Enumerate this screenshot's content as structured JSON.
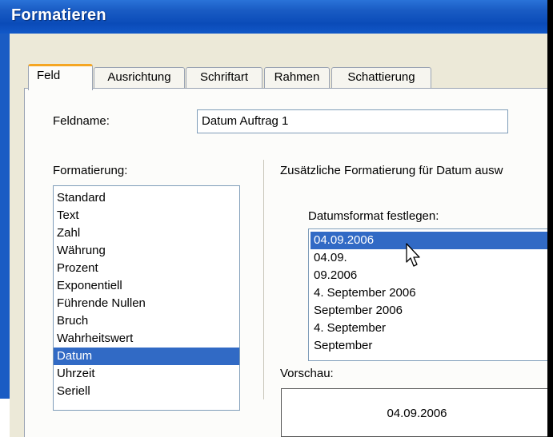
{
  "window": {
    "title": "Formatieren"
  },
  "tabs": [
    {
      "label": "Feld",
      "active": true
    },
    {
      "label": "Ausrichtung",
      "active": false
    },
    {
      "label": "Schriftart",
      "active": false
    },
    {
      "label": "Rahmen",
      "active": false
    },
    {
      "label": "Schattierung",
      "active": false
    }
  ],
  "field": {
    "label": "Feldname:",
    "value": "Datum Auftrag 1"
  },
  "formatting": {
    "label": "Formatierung:",
    "selected": "Datum",
    "items": [
      "Standard",
      "Text",
      "Zahl",
      "Währung",
      "Prozent",
      "Exponentiell",
      "Führende Nullen",
      "Bruch",
      "Wahrheitswert",
      "Datum",
      "Uhrzeit",
      "Seriell"
    ]
  },
  "additional": {
    "label": "Zusätzliche Formatierung für Datum ausw"
  },
  "date_format": {
    "label": "Datumsformat festlegen:",
    "selected": "04.09.2006",
    "items": [
      "04.09.2006",
      "04.09.",
      "09.2006",
      "4. September 2006",
      "September 2006",
      "4. September",
      "September"
    ]
  },
  "preview": {
    "label": "Vorschau:",
    "value": "04.09.2006"
  },
  "colors": {
    "title_bar": "#0a4bb8",
    "selection": "#316ac5",
    "active_tab_accent": "#f5a623",
    "dialog_bg": "#ece9d8"
  },
  "icons": {
    "cursor": "mouse-pointer-icon"
  }
}
